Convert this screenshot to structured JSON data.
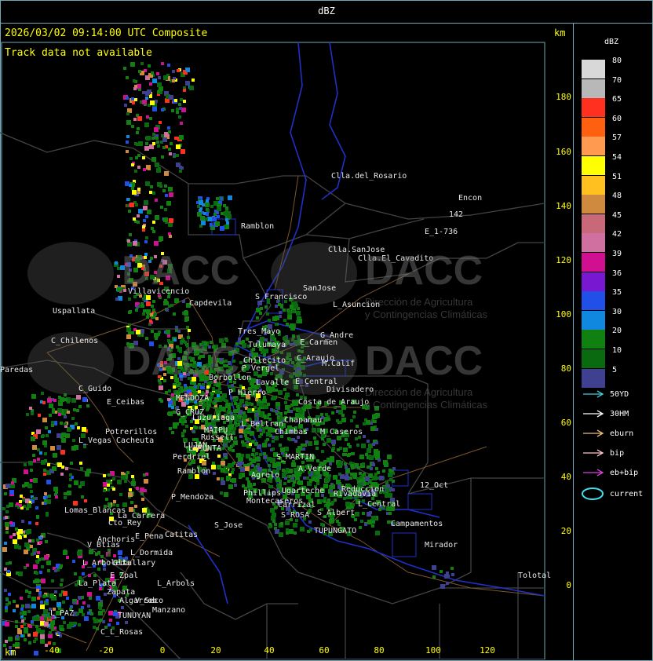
{
  "header": {
    "title": "dBZ"
  },
  "map": {
    "timestamp": "2026/03/02 09:14:00 UTC Composite",
    "track_note": "Track data not available",
    "km_label_top": "km",
    "km_label_bottom": "km",
    "y_ticks": [
      "180",
      "160",
      "140",
      "120",
      "100",
      "80",
      "60",
      "40",
      "20",
      "0"
    ],
    "x_ticks": [
      "-40",
      "-20",
      "0",
      "20",
      "40",
      "60",
      "80",
      "100",
      "120"
    ],
    "watermark_text": "DACC",
    "watermark_sub1": "Dirección de Agricultura",
    "watermark_sub2": "y Contingencias Climáticas",
    "places": [
      "Clla.del_Rosario",
      "Encon",
      "142",
      "E_1-736",
      "Ramblon",
      "Clla.SanJose",
      "Clla.El_Cavadito",
      "Uspallata",
      "Villavicencio",
      "Capdevila",
      "S_Francisco",
      "SanJose",
      "L_Asuncion",
      "C_Chilenos",
      "Tres_Mayo",
      "Tulumaya",
      "E_Carmen",
      "G_Andre",
      "Paredas",
      "Chilecito",
      "P_Vergel",
      "C_Araujo",
      "M.Calif",
      "C_Guido",
      "Borbollon",
      "Lavalle",
      "E_Central",
      "Divisadero",
      "E_Ceibas",
      "MENDOZA",
      "P_Hierro",
      "Costa_de_Araujo",
      "G_CRUZ",
      "L_Beltran",
      "Luzuriaga",
      "Potrerillos",
      "Russell",
      "Chimbas",
      "M_Caseros",
      "L_Vegas",
      "Cacheuta",
      "MAIPU",
      "Chapanau",
      "LUJAN",
      "LUMUNTA",
      "S_MARTIN",
      "Perdriel",
      "A.Verde",
      "Ramblon",
      "Agrelo",
      "P_Mendoza",
      "Ugarteche",
      "Rivadavia",
      "Phillips",
      "Montecaseros",
      "Reduccion",
      "12_Oct",
      "Lomas_Blancas",
      "La_Carrera",
      "Cto_Rey",
      "S_Jose",
      "Carrizal",
      "S_Albert",
      "L_Central",
      "S_ROSA",
      "Campamentos",
      "Catitas",
      "Anchoris",
      "E_Pena",
      "V_Btias",
      "TUPUNGATO",
      "Mirador",
      "L_Dormida",
      "L_Arboleda",
      "Gltallary",
      "E_Zpal",
      "La_Plata",
      "L_Arbols",
      "Zapata",
      "Algarrob",
      "V_Seco",
      "Tolotal",
      "L_PAZ",
      "Manzano",
      "TUNUYAN",
      "C_L_Rosas",
      "V_Flores"
    ]
  },
  "legend": {
    "title": "dBZ",
    "items": [
      {
        "label": "80",
        "color": "#d8d8d8"
      },
      {
        "label": "70",
        "color": "#b8b8b8"
      },
      {
        "label": "65",
        "color": "#ff3020"
      },
      {
        "label": "60",
        "color": "#ff6010"
      },
      {
        "label": "57",
        "color": "#ff9a50"
      },
      {
        "label": "54",
        "color": "#ffff00"
      },
      {
        "label": "51",
        "color": "#ffc020"
      },
      {
        "label": "48",
        "color": "#d08a40"
      },
      {
        "label": "45",
        "color": "#c86878"
      },
      {
        "label": "42",
        "color": "#d070a0"
      },
      {
        "label": "39",
        "color": "#d01090"
      },
      {
        "label": "36",
        "color": "#7818d0"
      },
      {
        "label": "35",
        "color": "#2050e8"
      },
      {
        "label": "30",
        "color": "#1088e0"
      },
      {
        "label": "20",
        "color": "#108010"
      },
      {
        "label": "10",
        "color": "#0a6a10"
      },
      {
        "label": "5",
        "color": "#404090"
      }
    ],
    "track_keys": [
      {
        "label": "50YD",
        "color": "#40d0e0"
      },
      {
        "label": "30HM",
        "color": "#ffffff"
      },
      {
        "label": "eburn",
        "color": "#f0c080"
      },
      {
        "label": "bip",
        "color": "#ffc8c8"
      },
      {
        "label": "eb+bip",
        "color": "#e040e0"
      },
      {
        "label": "current",
        "color": "#40e0f0"
      }
    ]
  }
}
